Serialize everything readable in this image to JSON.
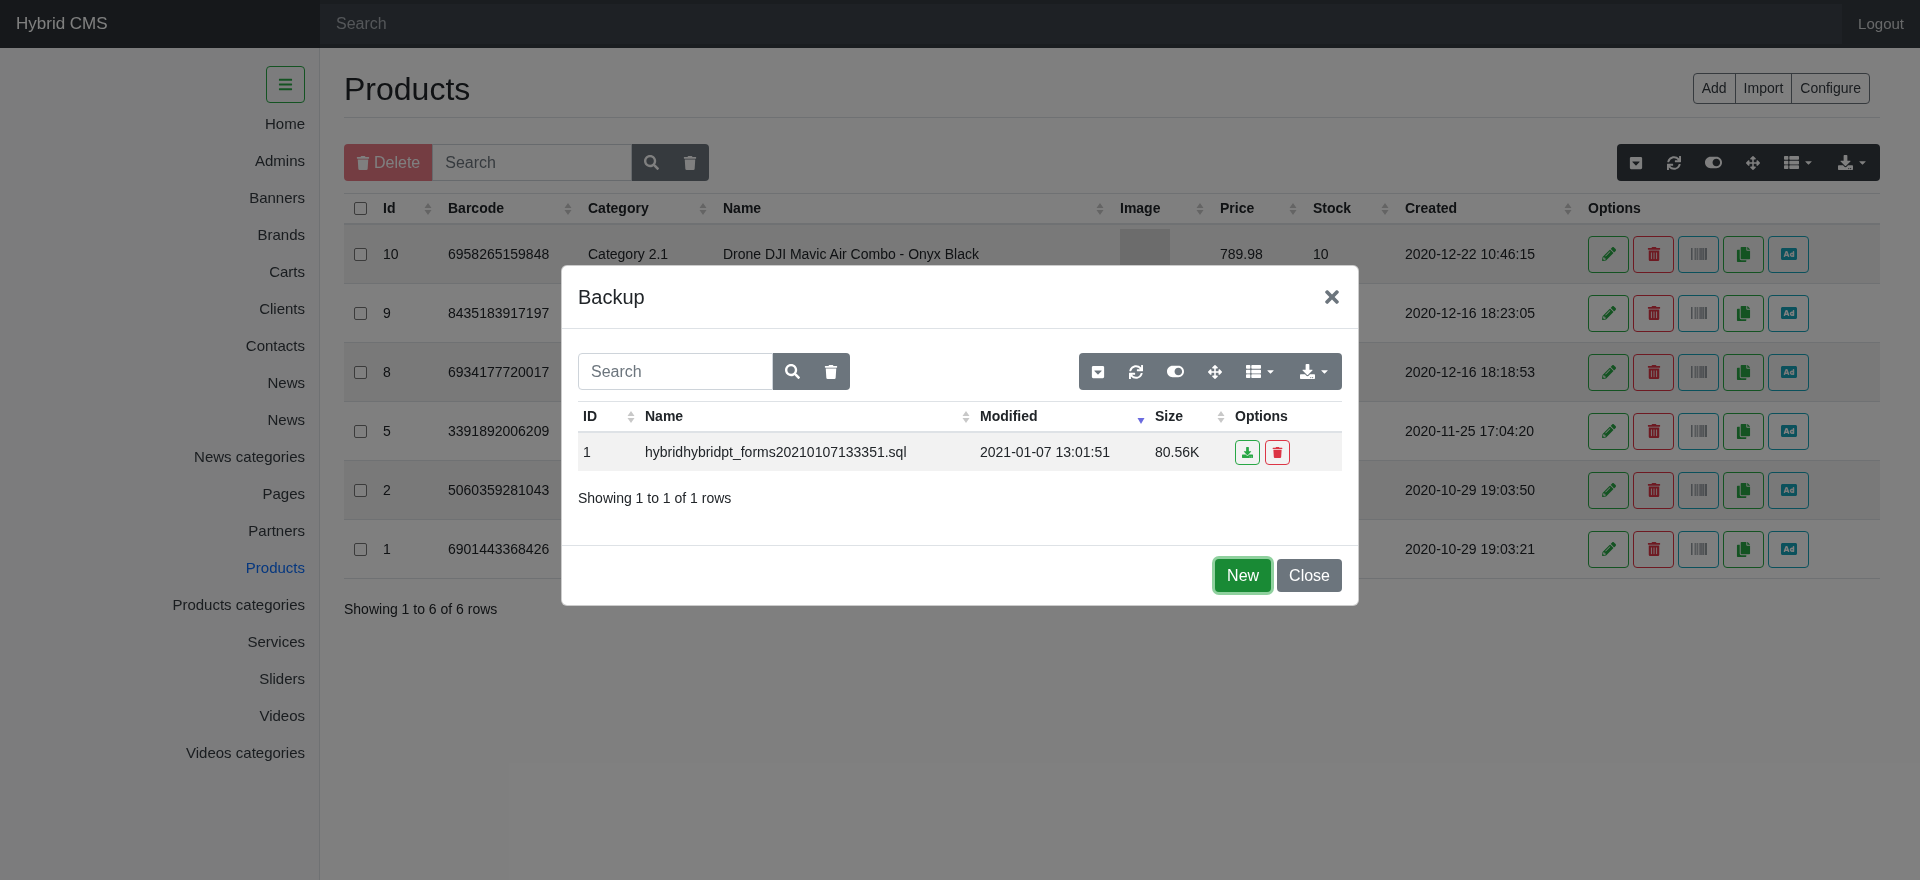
{
  "header": {
    "brand": "Hybrid CMS",
    "search_placeholder": "Search",
    "logout": "Logout"
  },
  "sidebar": {
    "items": [
      {
        "label": "Home",
        "selected": false
      },
      {
        "label": "Admins",
        "selected": false
      },
      {
        "label": "Banners",
        "selected": false
      },
      {
        "label": "Brands",
        "selected": false
      },
      {
        "label": "Carts",
        "selected": false
      },
      {
        "label": "Clients",
        "selected": false
      },
      {
        "label": "Contacts",
        "selected": false
      },
      {
        "label": "News",
        "selected": false
      },
      {
        "label": "News",
        "selected": false
      },
      {
        "label": "News categories",
        "selected": false
      },
      {
        "label": "Pages",
        "selected": false
      },
      {
        "label": "Partners",
        "selected": false
      },
      {
        "label": "Products",
        "selected": true
      },
      {
        "label": "Products categories",
        "selected": false
      },
      {
        "label": "Services",
        "selected": false
      },
      {
        "label": "Sliders",
        "selected": false
      },
      {
        "label": "Videos",
        "selected": false
      },
      {
        "label": "Videos categories",
        "selected": false
      }
    ]
  },
  "page": {
    "title": "Products",
    "actions": [
      "Add",
      "Import",
      "Configure"
    ],
    "delete_button": {
      "label": "Delete",
      "disabled": true
    },
    "search": {
      "placeholder": "Search"
    }
  },
  "table": {
    "select_all": {
      "checked": false
    },
    "columns": [
      {
        "label": "Id",
        "sortable": true,
        "sorted_desc": false
      },
      {
        "label": "Barcode",
        "sortable": true,
        "sorted_desc": false
      },
      {
        "label": "Category",
        "sortable": true,
        "sorted_desc": false
      },
      {
        "label": "Name",
        "sortable": true,
        "sorted_desc": false
      },
      {
        "label": "Image",
        "sortable": true,
        "sorted_desc": false
      },
      {
        "label": "Price",
        "sortable": true,
        "sorted_desc": false
      },
      {
        "label": "Stock",
        "sortable": true,
        "sorted_desc": false
      },
      {
        "label": "Created",
        "sortable": true,
        "sorted_desc": false
      },
      {
        "label": "Options",
        "sortable": false
      }
    ],
    "rows": [
      {
        "checked": false,
        "id": "10",
        "barcode": "6958265159848",
        "category": "Category 2.1",
        "name": "Drone DJI Mavic Air Combo - Onyx Black",
        "image": true,
        "price": "789.98",
        "stock": "10",
        "created": "2020-12-22 10:46:15"
      },
      {
        "checked": false,
        "id": "9",
        "barcode": "8435183917197",
        "created": "2020-12-16 18:23:05"
      },
      {
        "checked": false,
        "id": "8",
        "barcode": "6934177720017",
        "created": "2020-12-16 18:18:53"
      },
      {
        "checked": false,
        "id": "5",
        "barcode": "3391892006209",
        "created": "2020-11-25 17:04:20"
      },
      {
        "checked": false,
        "id": "2",
        "barcode": "5060359281043",
        "created": "2020-10-29 19:03:50"
      },
      {
        "checked": false,
        "id": "1",
        "barcode": "6901443368426",
        "created": "2020-10-29 19:03:21"
      }
    ],
    "footer": "Showing 1 to 6 of 6 rows"
  },
  "modal": {
    "title": "Backup",
    "search": {
      "placeholder": "Search"
    },
    "columns": [
      {
        "label": "ID",
        "sortable": true,
        "sorted_desc": false
      },
      {
        "label": "Name",
        "sortable": true,
        "sorted_desc": false
      },
      {
        "label": "Modified",
        "sortable": true,
        "sorted_desc": true
      },
      {
        "label": "Size",
        "sortable": true,
        "sorted_desc": false
      },
      {
        "label": "Options",
        "sortable": false
      }
    ],
    "rows": [
      {
        "id": "1",
        "name": "hybridhybridpt_forms20210107133351.sql",
        "modified": "2021-01-07 13:01:51",
        "size": "80.56K"
      }
    ],
    "footer": "Showing 1 to 1 of 1 rows",
    "buttons": [
      {
        "label": "New",
        "kind": "primary",
        "focused": true
      },
      {
        "label": "Close",
        "kind": "secondary",
        "focused": false
      }
    ]
  }
}
